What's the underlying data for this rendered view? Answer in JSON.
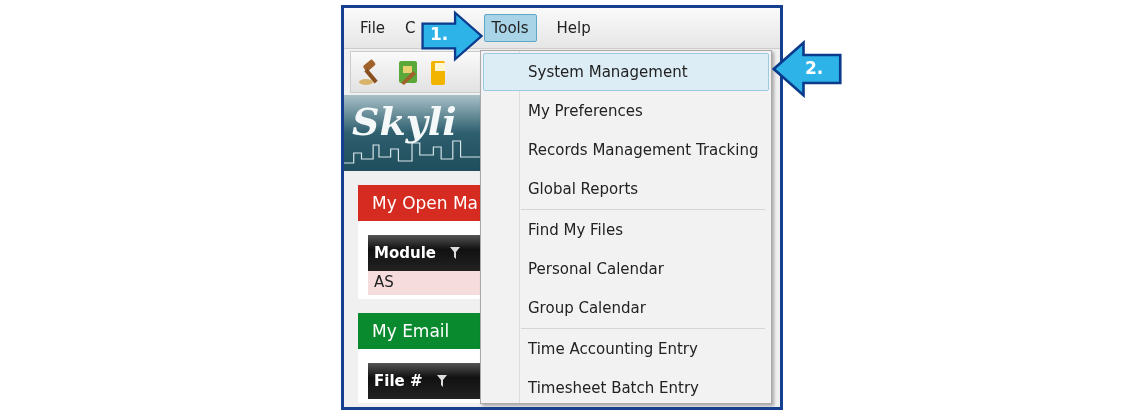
{
  "menu_bar": [
    {
      "label": "File",
      "selected": false
    },
    {
      "label": "C",
      "selected": false
    },
    {
      "label": "Tools",
      "selected": true
    },
    {
      "label": "Help",
      "selected": false
    }
  ],
  "banner": {
    "logo": "Skyli"
  },
  "panels": [
    {
      "title": "My Open Ma",
      "color": "#d52b20",
      "column": "Module",
      "row": "AS"
    },
    {
      "title": "My Email",
      "color": "#0a8a2e",
      "column": "File #"
    }
  ],
  "tools_menu": [
    {
      "kind": "item",
      "label": "System Management",
      "selected": true
    },
    {
      "kind": "item",
      "label": "My Preferences",
      "selected": false
    },
    {
      "kind": "item",
      "label": "Records Management Tracking",
      "selected": false
    },
    {
      "kind": "item",
      "label": "Global Reports",
      "selected": false
    },
    {
      "kind": "separator"
    },
    {
      "kind": "item",
      "label": "Find My Files",
      "selected": false
    },
    {
      "kind": "item",
      "label": "Personal Calendar",
      "selected": false
    },
    {
      "kind": "item",
      "label": "Group Calendar",
      "selected": false
    },
    {
      "kind": "separator"
    },
    {
      "kind": "item",
      "label": "Time Accounting Entry",
      "selected": false
    },
    {
      "kind": "item",
      "label": "Timesheet Batch Entry",
      "selected": false
    }
  ],
  "callouts": [
    {
      "label": "1."
    },
    {
      "label": "2."
    }
  ]
}
